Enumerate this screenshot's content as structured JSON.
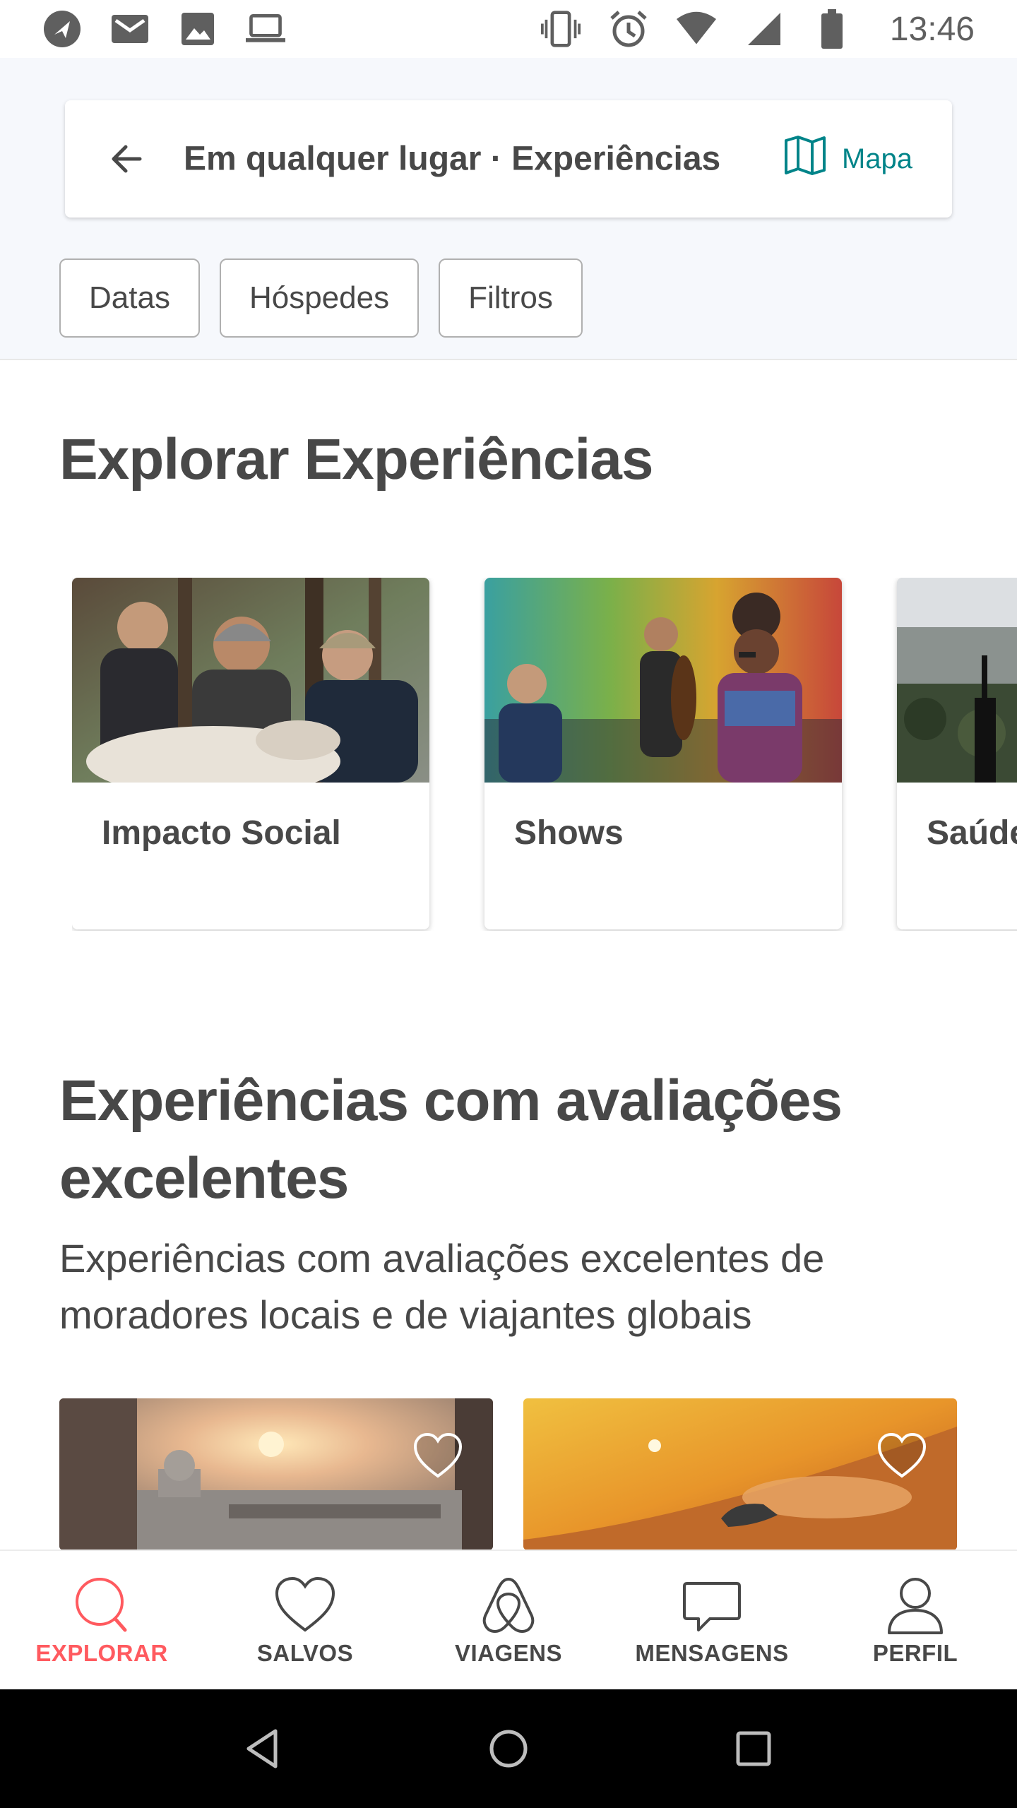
{
  "status_bar": {
    "time": "13:46",
    "left_icons": [
      "navigation-icon",
      "mail-icon",
      "image-icon",
      "laptop-icon"
    ],
    "right_icons": [
      "vibrate-icon",
      "alarm-icon",
      "wifi-icon",
      "signal-icon",
      "battery-icon"
    ]
  },
  "search": {
    "title": "Em qualquer lugar · Experiências",
    "map_label": "Mapa",
    "accent": "#008489"
  },
  "filters": [
    "Datas",
    "Hóspedes",
    "Filtros"
  ],
  "explore": {
    "heading": "Explorar Experiências",
    "categories": [
      {
        "label": "Impacto Social"
      },
      {
        "label": "Shows"
      },
      {
        "label": "Saúde e Bem-estar"
      }
    ]
  },
  "rated": {
    "heading": "Experiências com avaliações excelentes",
    "subtitle": "Experiências com avaliações excelentes de moradores locais e de viajantes globais"
  },
  "bottom_nav": {
    "active_color": "#ff5a5f",
    "items": [
      {
        "label": "EXPLORAR",
        "icon": "search-icon"
      },
      {
        "label": "SALVOS",
        "icon": "heart-icon"
      },
      {
        "label": "VIAGENS",
        "icon": "airbnb-logo-icon"
      },
      {
        "label": "MENSAGENS",
        "icon": "chat-icon"
      },
      {
        "label": "PERFIL",
        "icon": "person-icon"
      }
    ]
  }
}
